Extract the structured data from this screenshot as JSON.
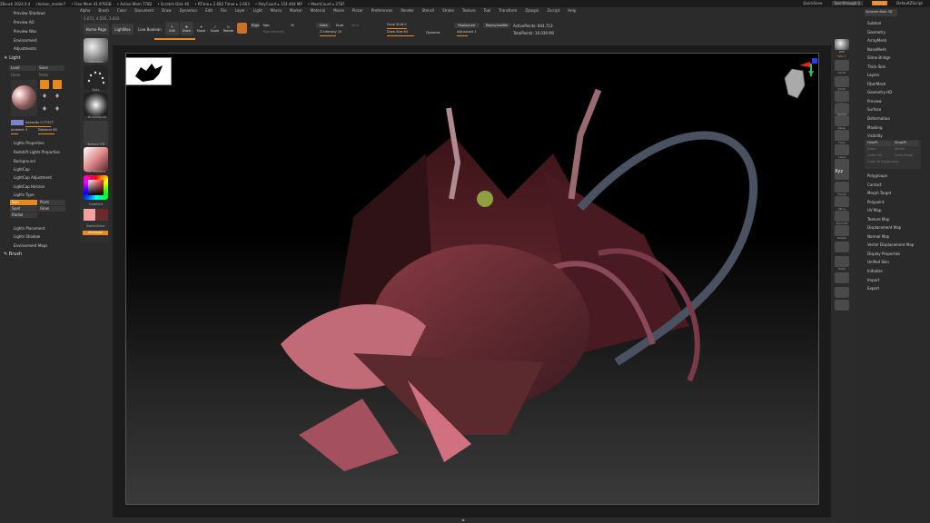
{
  "titlebar": {
    "app": "ZBrush 2024.0.4",
    "doc": "chicken_render7",
    "free_mem": "• Free Mem 41.976GB",
    "active_mem": "• Active Mem 7782",
    "scratch": "• Scratch Disk 40",
    "ztime": "• RTime ▸ 2.682 Timer ▸ 2.663",
    "polycount": "• PolyCount ▸ 154.464 MP",
    "meshcount": "• MeshCount ▸ 2787",
    "quicksave": "QuickSave",
    "see_through": "See-through  0",
    "menus": "Menus",
    "script": "DefaultZScript"
  },
  "coords": "1.671, 4.505, 3.603",
  "menubar": [
    "Alpha",
    "Brush",
    "Color",
    "Document",
    "Draw",
    "Dynamics",
    "Edit",
    "File",
    "Layer",
    "Light",
    "Macro",
    "Marker",
    "Material",
    "Movie",
    "Picker",
    "Preferences",
    "Render",
    "Stencil",
    "Stroke",
    "Texture",
    "Tool",
    "Transform",
    "Zplugin",
    "Zscript",
    "Help"
  ],
  "left_panel": {
    "top_items": [
      "Preview Shadows",
      "Preview AO",
      "Preview Wax",
      "Environment",
      "Adjustments"
    ],
    "light_title": "Light",
    "light_buttons": [
      "Load",
      "Save",
      "Undo",
      "Redo"
    ],
    "intensity_label": "Intensity 0.77327",
    "ambient_label": "Ambient 3",
    "distance_label": "Distance 80",
    "light_subs": [
      "Lights Properties",
      "Redshift Lights Properties",
      "Background",
      "LightCap",
      "LightCap Adjustment",
      "LightCap Horizon",
      "Lights Type"
    ],
    "light_types": [
      "Sun",
      "Point",
      "Spot",
      "Glow",
      "Radial"
    ],
    "bottom_items": [
      "Lights Placement",
      "Lights Shadow",
      "Environment Maps"
    ],
    "brush_title": "Brush"
  },
  "shelf": {
    "brush_label": "Standard",
    "stroke_label": "Dots",
    "alpha_label": "~BrushAlpha",
    "texture_label": "Texture Off",
    "material_label": "SkinShade4",
    "gradient_label": "Gradient",
    "switch_label": "SwitchColor",
    "alternate_label": "Alternate",
    "primary_color": "#f2a0a0",
    "secondary_color": "#6a2a2a"
  },
  "topbar": {
    "home_page": "Home Page",
    "lightbox": "LightBox",
    "live_boolean": "Live Boolean",
    "edit": "Edit",
    "draw": "Draw",
    "move": "Move",
    "scale": "Scale",
    "rotate": "Rotate",
    "mrgb": "Mrgb",
    "rgb": "Rgb",
    "m": "M",
    "zadd": "Zadd",
    "zsub": "Zsub",
    "zcut": "Zcut",
    "rgb_intensity": "Rgb Intensity",
    "z_intensity": "Z Intensity 25",
    "focal_shift": "Focal Shift 0",
    "draw_size": "Draw Size 64",
    "dynamic": "Dynamic",
    "replay_last": "ReplayLast",
    "replay_last_rel": "ReplayLastRel",
    "active_points": "ActivePoints: 844,713",
    "total_points": "TotalPoints: 16.039 Mil",
    "adjust_last": "AdjustLast 1"
  },
  "right_shelf": [
    "BPR",
    "SPix 3",
    "Scroll",
    "Zoom",
    "Actual",
    "AAHalf",
    "Persp",
    "Floor",
    "Local",
    "LSym",
    "Xyz",
    "Frame",
    "Move",
    "Zoom3D",
    "Rotate",
    "Line Fill",
    "PolyF",
    "Transp",
    "Solo",
    "Dynamic",
    "Ghost",
    "Xpose"
  ],
  "right_panel": {
    "spheres": "SphereInflate 3D",
    "items_top": [
      "Subtool",
      "Geometry",
      "ArrayMesh",
      "NanoMesh",
      "Slime Bridge",
      "Thick Skin",
      "Layers",
      "FiberMesh",
      "Geometry HD",
      "Preview",
      "Surface",
      "Deformation",
      "Masking",
      "Visibility"
    ],
    "visibility_buttons": [
      "HidePt",
      "ShowPt",
      "Grow",
      "Shrink",
      "Outer Hit",
      "Grow Rings",
      "Grow To Polygroups"
    ],
    "items_bottom": [
      "Polygroups",
      "Contact",
      "Morph Target",
      "Polypaint",
      "UV Map",
      "Texture Map",
      "Displacement Map",
      "Normal Map",
      "Vector Displacement Map",
      "Display Properties",
      "Unified Skin",
      "Initialize",
      "Import",
      "Export"
    ]
  }
}
